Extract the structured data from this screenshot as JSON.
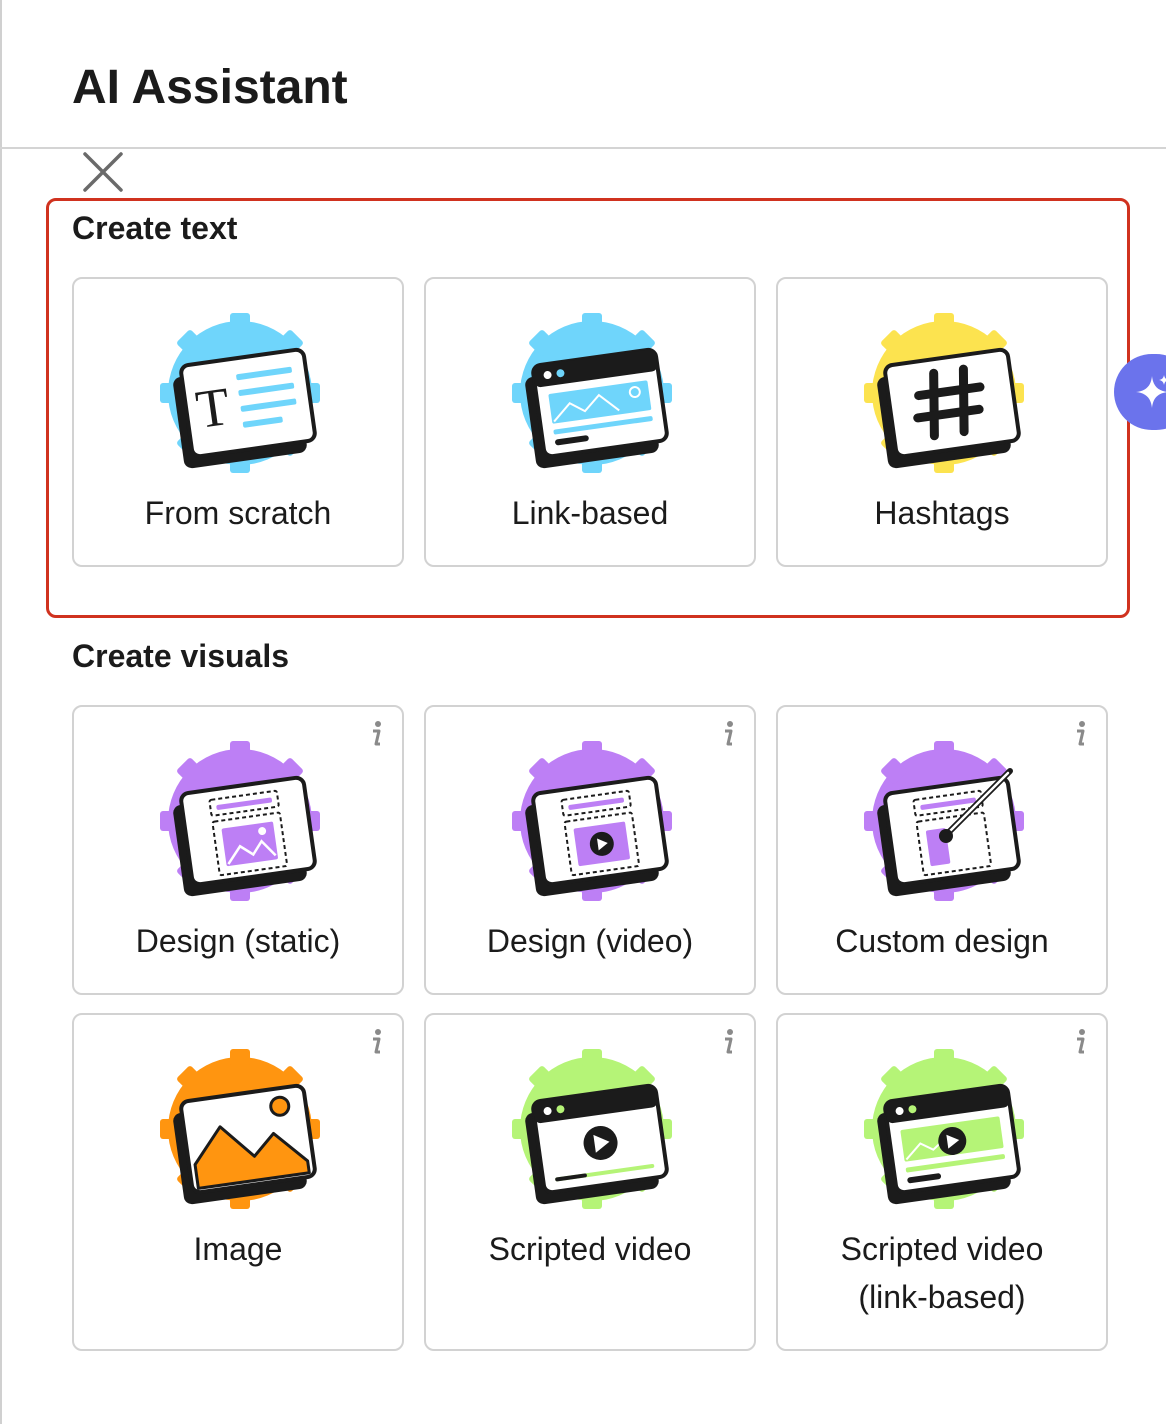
{
  "panel": {
    "title": "AI Assistant"
  },
  "colors": {
    "highlight": "#d0321f",
    "blue": "#6fd5fb",
    "yellow": "#fce34f",
    "purple": "#bd7ff5",
    "orange": "#ff9510",
    "green": "#b5f477",
    "sparkle_tab": "#6b73ec"
  },
  "sections": {
    "create_text": {
      "title": "Create text",
      "cards": [
        {
          "label": "From scratch",
          "icon": "text-document-icon"
        },
        {
          "label": "Link-based",
          "icon": "browser-window-icon"
        },
        {
          "label": "Hashtags",
          "icon": "hashtag-icon"
        }
      ]
    },
    "create_visuals": {
      "title": "Create visuals",
      "cards": [
        {
          "label": "Design (static)",
          "icon": "design-static-icon",
          "info_icon": "info-icon"
        },
        {
          "label": "Design (video)",
          "icon": "design-video-icon",
          "info_icon": "info-icon"
        },
        {
          "label": "Custom design",
          "icon": "custom-design-brush-icon",
          "info_icon": "info-icon"
        },
        {
          "label": "Image",
          "icon": "image-icon",
          "info_icon": "info-icon"
        },
        {
          "label": "Scripted video",
          "icon": "scripted-video-icon",
          "info_icon": "info-icon"
        },
        {
          "label_line1": "Scripted video",
          "label_line2": "(link-based)",
          "icon": "scripted-video-link-icon",
          "info_icon": "info-icon"
        }
      ]
    }
  },
  "icons": {
    "close": "close-icon",
    "side_tab": "sparkle-icon"
  }
}
